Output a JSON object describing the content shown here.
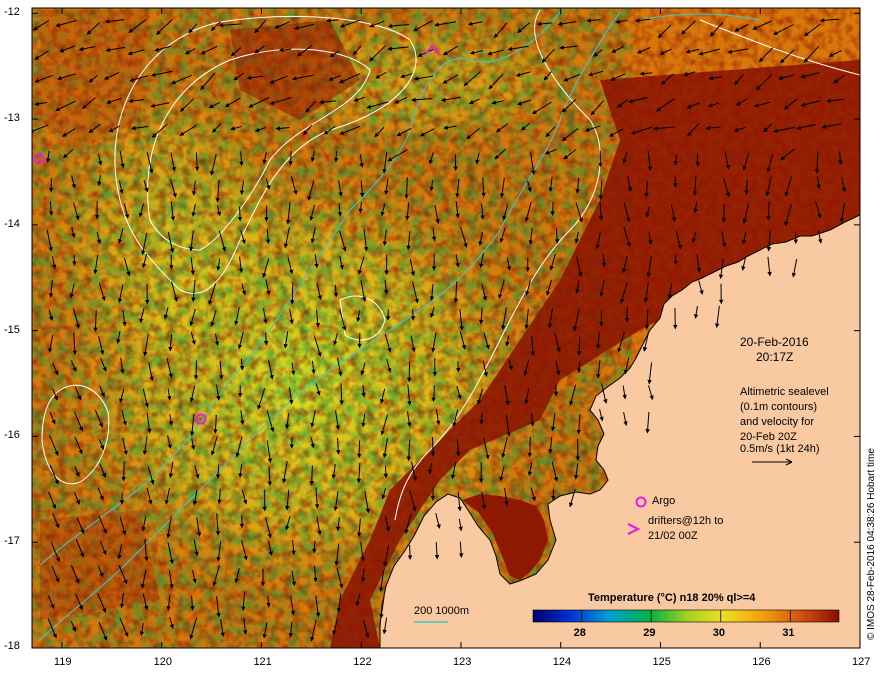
{
  "map": {
    "x_ticks": [
      "119",
      "120",
      "121",
      "122",
      "123",
      "124",
      "125",
      "126",
      "127"
    ],
    "y_ticks": [
      "-12",
      "-13",
      "-14",
      "-15",
      "-16",
      "-17",
      "-18"
    ],
    "x_range": [
      118.7,
      127
    ],
    "y_range": [
      -18,
      -11.95
    ]
  },
  "annotation": {
    "date": "20-Feb-2016",
    "time": "20:17Z",
    "alt_line1": "Altimetric sealevel",
    "alt_line2": "(0.1m contours)",
    "alt_line3": "and velocity for",
    "alt_line4": "20-Feb 20Z",
    "alt_line5": "0.5m/s (1kt 24h)",
    "argo_label": "Argo",
    "drifters_line1": "drifters@12h to",
    "drifters_line2": "21/02 00Z",
    "bathy_label": "200  1000m"
  },
  "colorbar": {
    "title": "Temperature (°C) n18 20% ql>=4",
    "ticks": [
      "28",
      "29",
      "30",
      "31"
    ],
    "tick_values": [
      28,
      29,
      30,
      31
    ],
    "range": [
      27.3,
      31.7
    ]
  },
  "credit": "© IMOS 28-Feb-2016 04:38:26 Hobart time",
  "colors": {
    "land": "#f9c9a1",
    "sst_warm": "#8a1200",
    "sst_orange": "#d6760a",
    "sst_yellow": "#e8d21c",
    "sst_green": "#8dc41e",
    "contour": "#ffffff",
    "bathy": "#3fc8c8",
    "argo": "#e020e0",
    "drifter": "#e020e0"
  }
}
